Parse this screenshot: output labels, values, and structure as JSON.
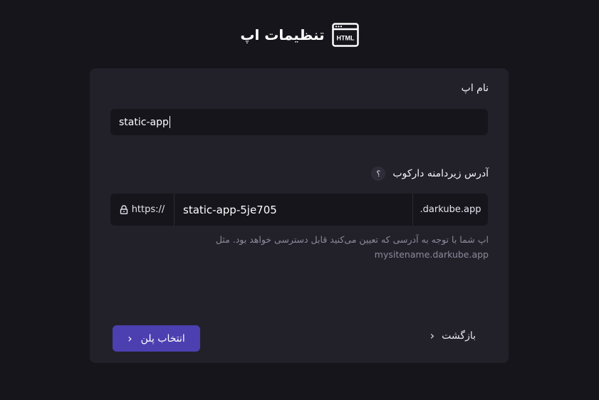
{
  "header": {
    "title": "تنظیمات اپ",
    "icon": "html-window-icon",
    "icon_text": "HTML"
  },
  "form": {
    "app_name_label": "نام اپ",
    "app_name_value": "static-app",
    "subdomain_label": "آدرس زیردامنه دارکوب",
    "help_icon_text": "؟",
    "url_prefix": "https://",
    "url_prefix_icon": "lock-icon",
    "subdomain_value": "static-app-5je705",
    "domain_suffix": ".darkube.app",
    "hint_text": "اپ شما با توجه به آدرسی که تعیین می‌کنید قابل دسترسی خواهد بود. مثل",
    "hint_example": "mysitename.darkube.app"
  },
  "actions": {
    "next_label": "انتخاب پلن",
    "back_label": "بازگشت"
  },
  "colors": {
    "background": "#16151c",
    "card": "#222129",
    "accent": "#4c3fb0",
    "hint": "#8c8a9c"
  }
}
